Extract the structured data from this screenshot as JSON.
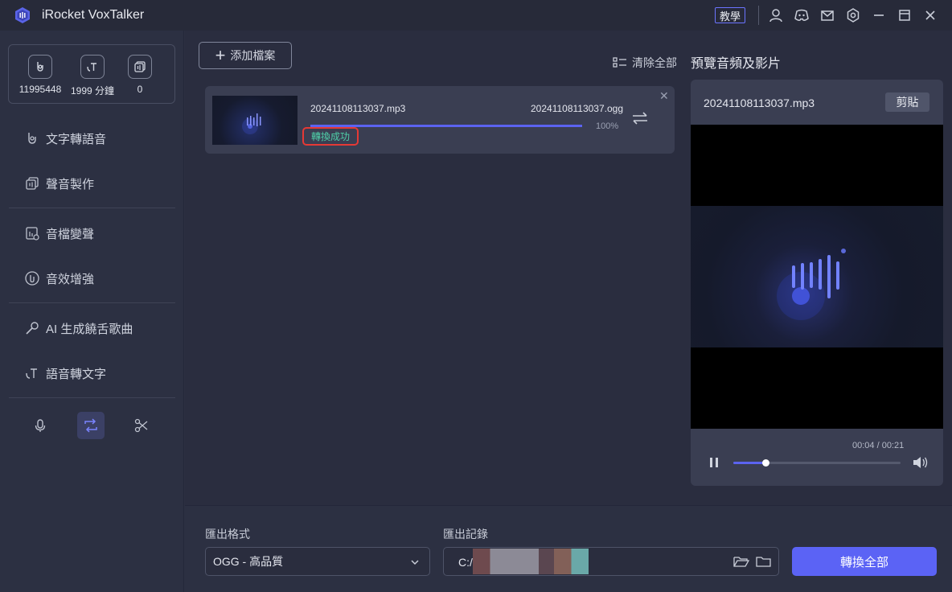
{
  "app": {
    "title": "iRocket VoxTalker",
    "tutorial_label": "教學"
  },
  "stats": [
    {
      "icon": "text-to-speech-icon",
      "value": "11995448"
    },
    {
      "icon": "voice-minutes-icon",
      "value": "1999 分鐘"
    },
    {
      "icon": "voice-clone-icon",
      "value": "0"
    }
  ],
  "sidebar": {
    "items": [
      {
        "label": "文字轉語音",
        "icon": "text-to-speech-icon"
      },
      {
        "label": "聲音製作",
        "icon": "voice-clone-icon"
      },
      {
        "label": "音檔變聲",
        "icon": "voice-changer-icon"
      },
      {
        "label": "音效增強",
        "icon": "audio-enhance-icon"
      },
      {
        "label": "AI 生成饒舌歌曲",
        "icon": "microphone-icon"
      },
      {
        "label": "語音轉文字",
        "icon": "speech-to-text-icon"
      }
    ]
  },
  "toolbar": {
    "add_label": "添加檔案",
    "clear_label": "清除全部"
  },
  "file": {
    "source": "20241108113037.mp3",
    "target": "20241108113037.ogg",
    "progress": 100,
    "progress_text": "100%",
    "status": "轉換成功"
  },
  "preview": {
    "title": "預覽音頻及影片",
    "filename": "20241108113037.mp3",
    "cut_label": "剪貼",
    "time": "00:04 / 00:21",
    "position": 0.19
  },
  "export": {
    "format_label": "匯出格式",
    "format_value": "OGG - 高品質",
    "path_label": "匯出記錄",
    "path_value": "C:/",
    "convert_label": "轉換全部"
  },
  "colors": {
    "accent": "#5b63f5",
    "success": "#4fd0a9",
    "highlight_border": "#e53935"
  }
}
